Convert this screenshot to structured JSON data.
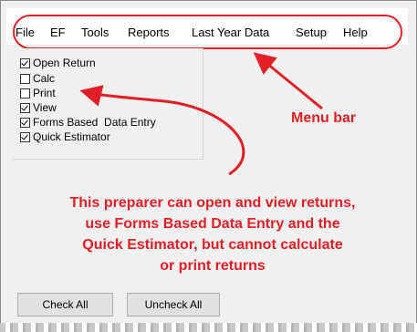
{
  "menu": {
    "items": [
      "File",
      "EF",
      "Tools",
      "Reports",
      "Last Year Data",
      "Setup",
      "Help"
    ]
  },
  "permissions": [
    {
      "label": "Open Return",
      "checked": true
    },
    {
      "label": "Calc",
      "checked": false
    },
    {
      "label": "Print",
      "checked": false
    },
    {
      "label": "View",
      "checked": true
    },
    {
      "label": "Forms Based  Data Entry",
      "checked": true
    },
    {
      "label": "Quick Estimator",
      "checked": true
    }
  ],
  "callouts": {
    "menu_bar": "Menu bar",
    "description_lines": [
      "This preparer can open and view returns,",
      "use Forms Based Data Entry and the",
      "Quick Estimator, but cannot calculate",
      "or print returns"
    ]
  },
  "buttons": {
    "check_all": "Check All",
    "uncheck_all": "Uncheck All"
  },
  "colors": {
    "annotation": "#e21f26",
    "dialog_bg": "#f0f0f0"
  }
}
